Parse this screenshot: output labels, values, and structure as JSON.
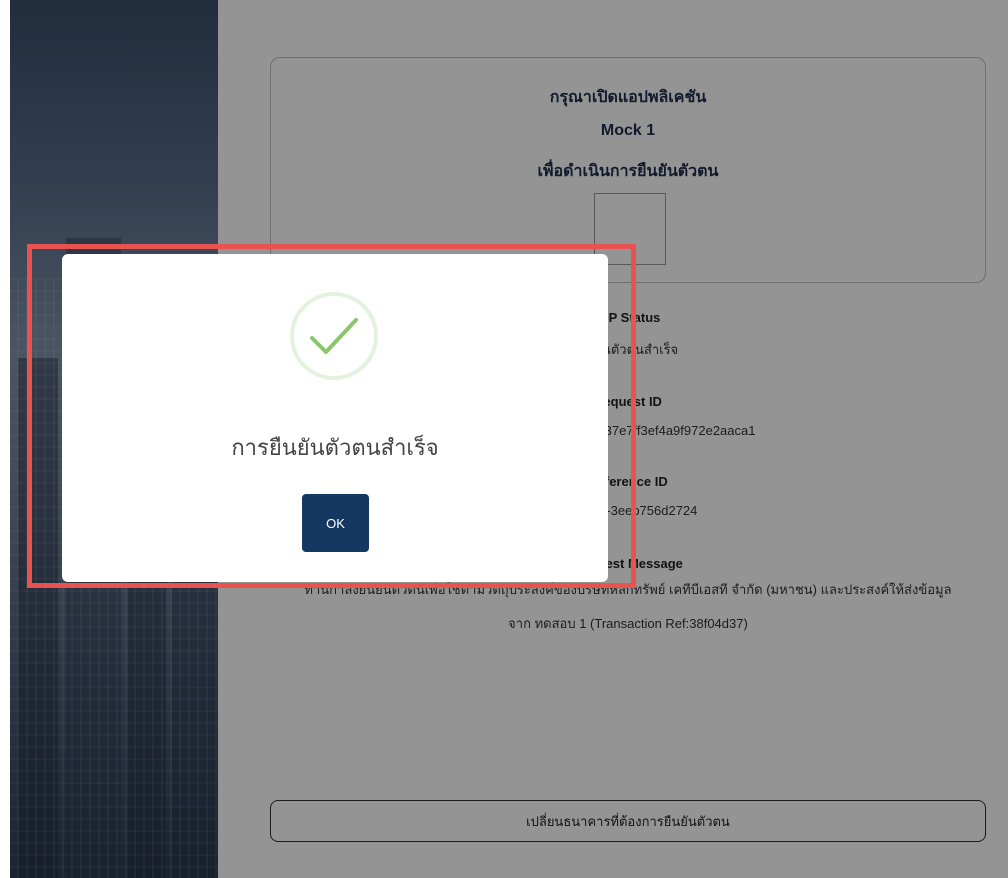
{
  "card": {
    "line1": "กรุณาเปิดแอปพลิเคชัน",
    "line2": "Mock 1",
    "line3": "เพื่อดำเนินการยืนยันตัวตน"
  },
  "info": {
    "status_label": "IDP Status",
    "status_value": "ยืนยันตัวตนสำเร็จ",
    "request_label": "Request ID",
    "request_value": "fd58527eac92a5b37e7ff3ef4a9f972e2aaca1",
    "reference_label": "Reference ID",
    "reference_value": "97-bb17-3eeb756d2724",
    "message_label": "Request Message",
    "message_line1": "ท่านกำลังยืนยันตัวตนเพื่อใช้ตามวัตถุประสงค์ของบริษัทหลักทรัพย์ เคทีบีเอสที จำกัด (มหาชน) และประสงค์ให้ส่งข้อมูล",
    "message_line2": "จาก ทดสอบ 1 (Transaction Ref:38f04d37)"
  },
  "change_bank_label": "เปลี่ยนธนาคารที่ต้องการยืนยันตัวตน",
  "modal": {
    "title": "การยืนยันตัวตนสำเร็จ",
    "ok_label": "OK",
    "icon": "check-icon"
  },
  "colors": {
    "brand_navy": "#153862",
    "success_green": "#8ac66d",
    "highlight_red": "#e8534f"
  }
}
